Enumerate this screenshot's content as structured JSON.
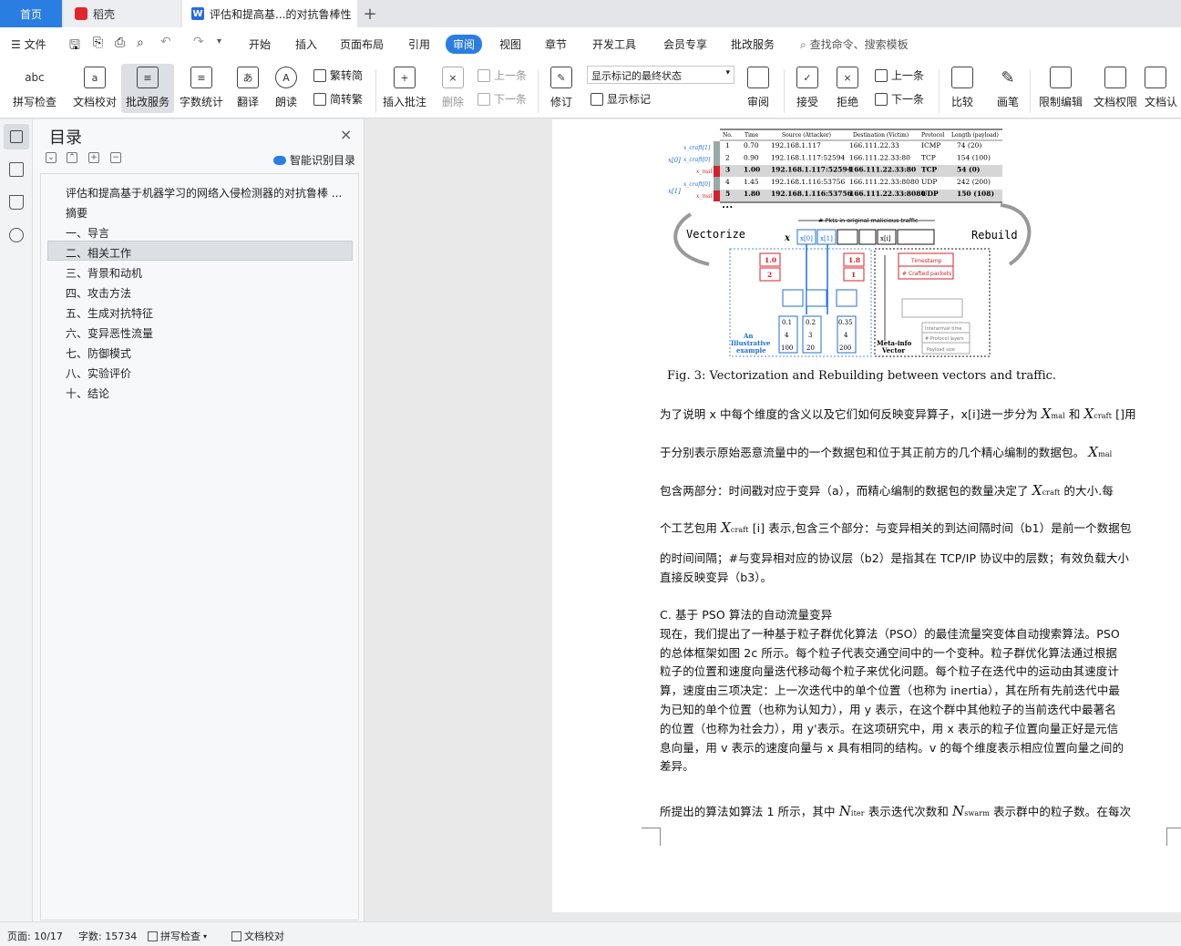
{
  "tabs": {
    "home": "首页",
    "daoke": "稻壳",
    "doc": "评估和提高基...的对抗鲁棒性",
    "add": "+"
  },
  "menu": {
    "file": "文件",
    "items": [
      "开始",
      "插入",
      "页面布局",
      "引用",
      "审阅",
      "视图",
      "章节",
      "开发工具",
      "会员专享",
      "批改服务"
    ],
    "search": "查找命令、搜索模板"
  },
  "ribbon": {
    "spell_check": "拼写检查",
    "doc_proof": "文档校对",
    "pizhu_service": "批改服务",
    "word_count": "字数统计",
    "translate": "翻译",
    "read_aloud": "朗读",
    "trad_conv": "繁转简",
    "simp_conv": "简转繁",
    "insert_comment": "插入批注",
    "delete": "删除",
    "prev": "上一条",
    "next": "下一条",
    "revise": "修订",
    "markup_state": "显示标记的最终状态",
    "show_markup": "显示标记",
    "review": "审阅",
    "accept": "接受",
    "reject": "拒绝",
    "prev2": "上一条",
    "next2": "下一条",
    "compare": "比较",
    "pen": "画笔",
    "restrict_edit": "限制编辑",
    "doc_perm": "文档权限",
    "doc_auth": "文档认"
  },
  "toc": {
    "title": "目录",
    "smart": "智能识别目录",
    "items": [
      "评估和提高基于机器学习的网络入侵检测器的对抗鲁棒 ...",
      "摘要",
      "一、导言",
      "二、相关工作",
      "三、背景和动机",
      "四、攻击方法",
      "五、生成对抗特征",
      "六、变异恶性流量",
      "七、防御模式",
      "八、实验评价",
      "十、结论"
    ]
  },
  "figure": {
    "table_headers": [
      "No.",
      "Time",
      "Source (Attacker)",
      "Destination (Victim)",
      "Protocol",
      "Length (payload)"
    ],
    "rows": [
      [
        "1",
        "0.70",
        "192.168.1.117",
        "166.111.22.33",
        "ICMP",
        "74 (20)"
      ],
      [
        "2",
        "0.90",
        "192.168.1.117:52594",
        "166.111.22.33:80",
        "TCP",
        "154 (100)"
      ],
      [
        "3",
        "1.00",
        "192.168.1.117:52594",
        "166.111.22.33:80",
        "TCP",
        "54 (0)"
      ],
      [
        "4",
        "1.45",
        "192.168.1.116:53756",
        "166.111.22.33:8080",
        "UDP",
        "242 (200)"
      ],
      [
        "5",
        "1.80",
        "192.168.1.116:53756",
        "166.111.22.33:8080",
        "UDP",
        "150 (108)"
      ]
    ],
    "vectorize": "Vectorize",
    "rebuild": "Rebuild",
    "pkts_label": "# Pkts in original malicious traffic",
    "example_label": "An Illustrative example",
    "meta_label": "Meta-info Vector",
    "timestamp": "Timestamp",
    "crafted": "# Crafted packets",
    "vals_left_top": [
      "1.0",
      "2"
    ],
    "vals_right_top": [
      "1.8",
      "1"
    ],
    "col1": [
      "0.1",
      "4",
      "100"
    ],
    "col2": [
      "0.2",
      "3",
      "20"
    ],
    "col3": [
      "0.35",
      "4",
      "200"
    ],
    "meta_rows": [
      "Interarrival time",
      "# Protocol layers",
      "Payload size"
    ],
    "caption": "Fig. 3:  Vectorization and Rebuilding between vectors and traffic."
  },
  "body": {
    "p1_l1": [
      "为了说明 x 中每个维度的含义以及它们如何反映变异算子，x[i]进一步分为 ",
      "和 ",
      "[]用"
    ],
    "p1_l2": "于分别表示原始恶意流量中的一个数据包和位于其正前方的几个精心编制的数据包。",
    "p1_l3": [
      "包含两部分：时间戳对应于变异（a），而精心编制的数据包的数量决定了 ",
      " 的大小.每"
    ],
    "p1_l4": [
      "个工艺包用 ",
      "[i] 表示,包含三个部分：与变异相关的到达间隔时间（b1）是前一个数据包"
    ],
    "p1_l5": "的时间间隔；#与变异相对应的协议层（b2）是指其在 TCP/IP 协议中的层数；有效负载大小",
    "p1_l6": "直接反映变异（b3）。",
    "section": "C.  基于 PSO 算法的自动流量变异",
    "p2": [
      "现在，我们提出了一种基于粒子群优化算法（PSO）的最佳流量突变体自动搜索算法。PSO",
      "的总体框架如图 2c 所示。每个粒子代表交通空间中的一个变种。粒子群优化算法通过根据",
      "粒子的位置和速度向量迭代移动每个粒子来优化问题。每个粒子在迭代中的运动由其速度计",
      "算，速度由三项决定：上一次迭代中的单个位置（也称为 inertia），其在所有先前迭代中最",
      "为已知的单个位置（也称为认知力），用 y 表示，在这个群中其他粒子的当前迭代中最著名",
      "的位置（也称为社会力），用 y'表示。在这项研究中，用 x 表示的粒子位置向量正好是元信",
      "息向量，用 v 表示的速度向量与 x 具有相同的结构。v 的每个维度表示相应位置向量之间的",
      "差异。"
    ],
    "p3": [
      "所提出的算法如算法 1 所示，其中 ",
      "表示迭代次数和 ",
      "表示群中的粒子数。在每次"
    ],
    "sym_X": "X",
    "sym_mal": "mal",
    "sym_craft": "craft",
    "sym_N": "N",
    "sym_iter": "iter",
    "sym_swarm": "swarm"
  },
  "status": {
    "page": "页面: 10/17",
    "words": "字数: 15734",
    "spell": "拼写检查",
    "proof": "文档校对"
  }
}
